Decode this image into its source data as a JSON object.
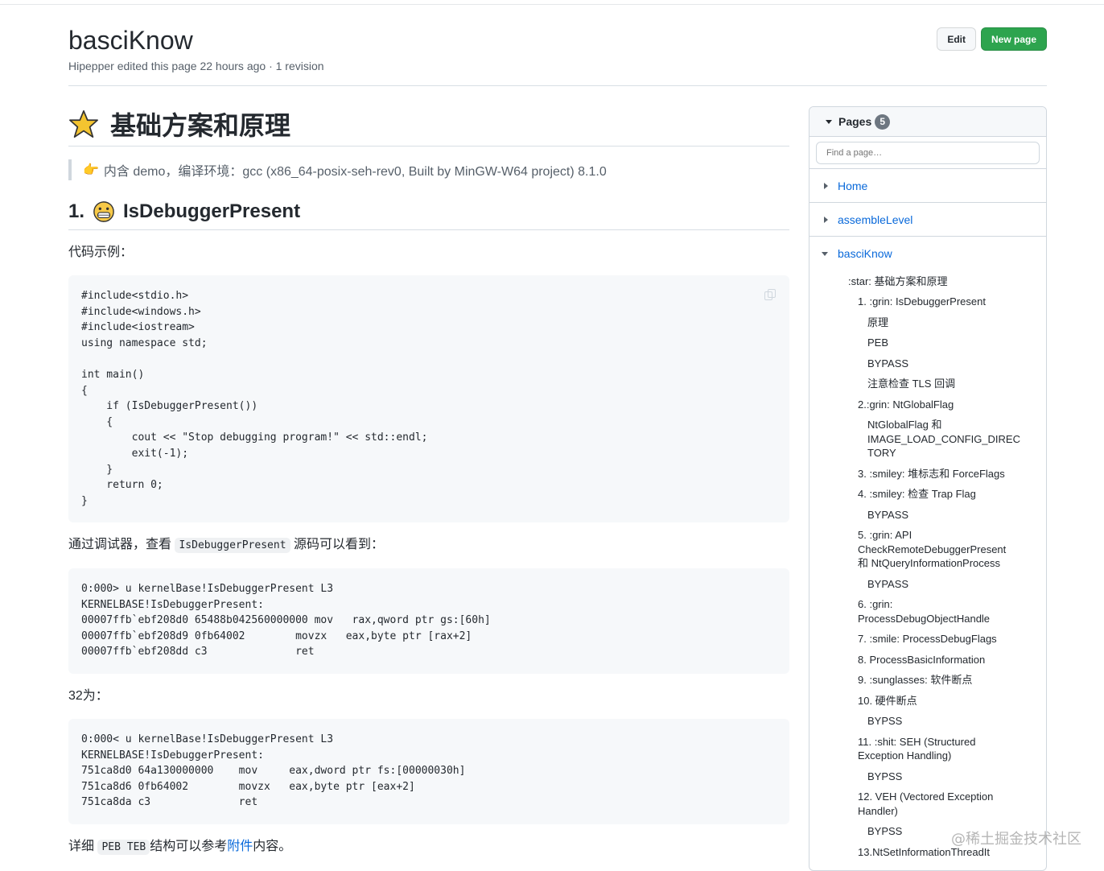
{
  "header": {
    "title": "basciKnow",
    "meta": "Hipepper edited this page 22 hours ago · 1 revision",
    "edit_label": "Edit",
    "new_page_label": "New page"
  },
  "content": {
    "h1": "基础方案和原理",
    "quote": "内含 demo，编译环境：gcc (x86_64-posix-seh-rev0, Built by MinGW-W64 project) 8.1.0",
    "h2_num": "1.",
    "h2_text": "IsDebuggerPresent",
    "p1": "代码示例：",
    "code1": "#include<stdio.h>\n#include<windows.h>\n#include<iostream>\nusing namespace std;\n\nint main()\n{\n    if (IsDebuggerPresent())\n    {\n        cout << \"Stop debugging program!\" << std::endl;\n        exit(-1);\n    }\n    return 0;\n}",
    "p2_before": "通过调试器，查看",
    "p2_code": "IsDebuggerPresent",
    "p2_after": "源码可以看到：",
    "code2": "0:000> u kernelBase!IsDebuggerPresent L3\nKERNELBASE!IsDebuggerPresent:\n00007ffb`ebf208d0 65488b042560000000 mov   rax,qword ptr gs:[60h]\n00007ffb`ebf208d9 0fb64002        movzx   eax,byte ptr [rax+2]\n00007ffb`ebf208dd c3              ret",
    "p3": "32为：",
    "code3": "0:000< u kernelBase!IsDebuggerPresent L3\nKERNELBASE!IsDebuggerPresent:\n751ca8d0 64a130000000    mov     eax,dword ptr fs:[00000030h]\n751ca8d6 0fb64002        movzx   eax,byte ptr [eax+2]\n751ca8da c3              ret",
    "p4_before": "详细",
    "p4_code": "PEB TEB",
    "p4_mid": "结构可以参考",
    "p4_link": "附件",
    "p4_after": "内容。"
  },
  "sidebar": {
    "title": "Pages",
    "count": "5",
    "search_placeholder": "Find a page…",
    "pages": [
      {
        "label": "Home"
      },
      {
        "label": "assembleLevel"
      },
      {
        "label": "basciKnow"
      }
    ],
    "toc": [
      "注意检查 TLS 回调",
      "2.:grin: NtGlobalFlag",
      "NtGlobalFlag 和",
      "IMAGE_LOAD_CONFIG_DIREC",
      "TORY",
      "3. :smiley: 堆标志和 ForceFlags",
      "4. :smiley: 检查 Trap Flag",
      "BYPASS",
      "5. :grin: API",
      "CheckRemoteDebuggerPresent",
      "和 NtQueryInformationProcess",
      "BYPASS",
      "6. :grin:",
      "ProcessDebugObjectHandle",
      "7. :smile: ProcessDebugFlags",
      "8. ProcessBasicInformation",
      "9. :sunglasses: 软件断点",
      "10. 硬件断点",
      "BYPSS",
      "11. :shit: SEH (Structured",
      "Exception Handling)",
      "BYPSS",
      "12. VEH (Vectored Exception",
      "Handler)",
      "BYPSS",
      "13.NtSetInformationThreadIt"
    ],
    "toc_top": [
      ":star: 基础方案和原理",
      "1. :grin: IsDebuggerPresent",
      "原理",
      "PEB",
      "BYPASS"
    ]
  },
  "watermark": "@稀土掘金技术社区",
  "colors": {
    "accent": "#0969da",
    "new_button": "#2da44e",
    "star": "#f4c430"
  }
}
